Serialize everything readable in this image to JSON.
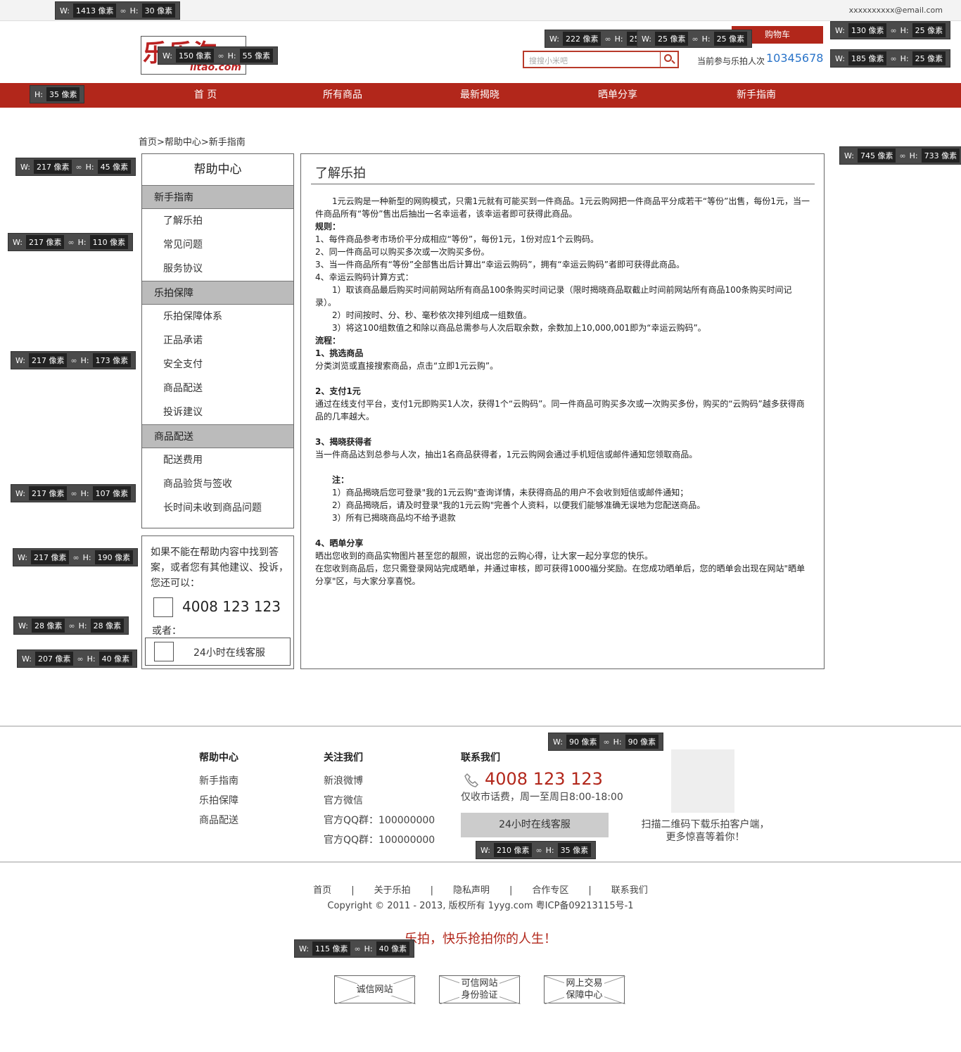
{
  "topbar": {
    "email": "xxxxxxxxxx@email.com"
  },
  "header": {
    "logo_main": "乐乐淘",
    "logo_sub": "lltao.com",
    "search_placeholder": "搜搜小米吧",
    "cart_label": "购物车",
    "count_label": "当前参与乐拍人次",
    "count_value": "10345678"
  },
  "nav": [
    "首 页",
    "所有商品",
    "最新揭晓",
    "晒单分享",
    "新手指南"
  ],
  "breadcrumb": "首页>帮助中心>新手指南",
  "sidebar": {
    "title": "帮助中心",
    "sections": [
      {
        "title": "新手指南",
        "items": [
          "了解乐拍",
          "常见问题",
          "服务协议"
        ]
      },
      {
        "title": "乐拍保障",
        "items": [
          "乐拍保障体系",
          "正品承诺",
          "安全支付",
          "商品配送",
          "投诉建议"
        ]
      },
      {
        "title": "商品配送",
        "items": [
          "配送费用",
          "商品验货与签收",
          "长时间未收到商品问题"
        ]
      }
    ]
  },
  "contact": {
    "text": "如果不能在帮助内容中找到答案，或者您有其他建议、投诉，您还可以：",
    "phone": "4008 123 123",
    "or": "或者：",
    "service": "24小时在线客服"
  },
  "main": {
    "heading": "了解乐拍",
    "paragraphs": [
      {
        "text": "　　1元云购是一种新型的网购模式，只需1元就有可能买到一件商品。1元云购网把一件商品平分成若干“等份”出售，每份1元，当一件商品所有“等份”售出后抽出一名幸运者，该幸运者即可获得此商品。",
        "bold": false
      },
      {
        "text": "规则：",
        "bold": true
      },
      {
        "text": "1、每件商品参考市场价平分成相应“等份”，每份1元，1份对应1个云购码。",
        "bold": false
      },
      {
        "text": "2、同一件商品可以购买多次或一次购买多份。",
        "bold": false
      },
      {
        "text": "3、当一件商品所有“等份”全部售出后计算出“幸运云购码”，拥有“幸运云购码”者即可获得此商品。",
        "bold": false
      },
      {
        "text": "4、幸运云购码计算方式：",
        "bold": false
      },
      {
        "text": "　　1）取该商品最后购买时间前网站所有商品100条购买时间记录（限时揭晓商品取截止时间前网站所有商品100条购买时间记录）。",
        "bold": false
      },
      {
        "text": "　　2）时间按时、分、秒、毫秒依次排列组成一组数值。",
        "bold": false
      },
      {
        "text": "　　3）将这100组数值之和除以商品总需参与人次后取余数，余数加上10,000,001即为“幸运云购码”。",
        "bold": false
      },
      {
        "text": "流程：",
        "bold": true
      },
      {
        "text": "1、挑选商品",
        "bold": true
      },
      {
        "text": "分类浏览或直接搜索商品，点击“立即1元云购”。",
        "bold": false
      },
      {
        "text": "",
        "bold": false
      },
      {
        "text": "2、支付1元",
        "bold": true
      },
      {
        "text": "通过在线支付平台，支付1元即购买1人次，获得1个“云购码”。同一件商品可购买多次或一次购买多份，购买的“云购码”越多获得商品的几率越大。",
        "bold": false
      },
      {
        "text": "",
        "bold": false
      },
      {
        "text": "3、揭晓获得者",
        "bold": true
      },
      {
        "text": "当一件商品达到总参与人次，抽出1名商品获得者，1元云购网会通过手机短信或邮件通知您领取商品。",
        "bold": false
      },
      {
        "text": "",
        "bold": false
      },
      {
        "text": "　　注：",
        "bold": true
      },
      {
        "text": "　　1）商品揭晓后您可登录\"我的1元云购\"查询详情，未获得商品的用户不会收到短信或邮件通知；",
        "bold": false
      },
      {
        "text": "　　2）商品揭晓后，请及时登录\"我的1元云购\"完善个人资料，以便我们能够准确无误地为您配送商品。",
        "bold": false
      },
      {
        "text": "　　3）所有已揭晓商品均不给予退款",
        "bold": false
      },
      {
        "text": "",
        "bold": false
      },
      {
        "text": "4、晒单分享",
        "bold": true
      },
      {
        "text": "晒出您收到的商品实物图片甚至您的靓照，说出您的云购心得，让大家一起分享您的快乐。",
        "bold": false
      },
      {
        "text": "在您收到商品后，您只需登录网站完成晒单，并通过审核，即可获得1000福分奖励。在您成功晒单后，您的晒单会出现在网站\"晒单分享\"区，与大家分享喜悦。",
        "bold": false
      }
    ]
  },
  "footer": {
    "col1": {
      "title": "帮助中心",
      "items": [
        "新手指南",
        "乐拍保障",
        "商品配送"
      ]
    },
    "col2": {
      "title": "关注我们",
      "items": [
        "新浪微博",
        "官方微信",
        "官方QQ群：100000000",
        "官方QQ群：100000000"
      ]
    },
    "col3": {
      "title": "联系我们",
      "phone": "4008 123 123",
      "hours": "仅收市话费，周一至周日8:00-18:00",
      "service": "24小时在线客服"
    },
    "qr_text": "扫描二维码下载乐拍客户端，更多惊喜等着你！",
    "links": [
      "首页",
      "|",
      "关于乐拍",
      "|",
      "隐私声明",
      "|",
      "合作专区",
      "|",
      "联系我们"
    ],
    "copyright": "Copyright © 2011 - 2013, 版权所有 1yyg.com 粤ICP备09213115号-1",
    "slogan": "乐拍，快乐抢拍你的人生！",
    "badges": [
      [
        "诚信网站"
      ],
      [
        "可信网站",
        "身份验证"
      ],
      [
        "网上交易",
        "保障中心"
      ]
    ]
  },
  "annotations": [
    {
      "w": "1413",
      "h": "30"
    },
    {
      "w": "150",
      "h": "55"
    },
    {
      "w": "222",
      "h": "25"
    },
    {
      "w": "25",
      "h": "25"
    },
    {
      "w": "130",
      "h": "25"
    },
    {
      "w": "185",
      "h": "25"
    },
    {
      "w": "",
      "h": "35"
    },
    {
      "w": "217",
      "h": "45"
    },
    {
      "w": "217",
      "h": "110"
    },
    {
      "w": "217",
      "h": "173"
    },
    {
      "w": "217",
      "h": "107"
    },
    {
      "w": "217",
      "h": "190"
    },
    {
      "w": "28",
      "h": "28"
    },
    {
      "w": "207",
      "h": "40"
    },
    {
      "w": "745",
      "h": "733"
    },
    {
      "w": "90",
      "h": "90"
    },
    {
      "w": "210",
      "h": "35"
    },
    {
      "w": "115",
      "h": "40"
    }
  ],
  "annotation_labels": {
    "w": "W:",
    "h": "H:",
    "unit": "像素"
  }
}
